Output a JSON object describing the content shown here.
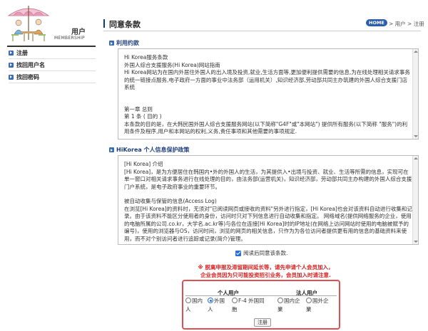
{
  "sidebar": {
    "logo_title": "用户",
    "logo_subtitle": "MEMBERSHIP",
    "items": [
      {
        "label": "注册"
      },
      {
        "label": "找回用户名"
      },
      {
        "label": "找回密码"
      }
    ]
  },
  "header": {
    "title": "同意条款",
    "home_label": "HOME",
    "breadcrumb": "> 用户 > 注册"
  },
  "terms": {
    "heading": "利用约款",
    "lines": [
      "Hi Korea服务条款",
      "外国人综合支援服务(Hi Korea)网站指南",
      "Hi Korea网站为在国内外居住外国人的出入境及投资,就业,生活方面等,更加便利提供需要的信息,为在线处理相关请求事务的统一链接点服务,电子政府一方面的事业中法务部（运用机关）,知识经济部,劳动部共同主办筑建的外国人综合支援门店系统",
      "",
      "第一章 总则",
      "第 1 条 ( 目的 )",
      "本条款的目的是，在大韩民国外国人综合支援服务网站(以下简称\"G4F\"或\"本网站\") 提供所有服务(以下简称 \"服务\")的利用条件及程序,用户和本网站的权利,义务,责任事项和其他需要的事项规定."
    ]
  },
  "privacy": {
    "heading": "HiKorea 个人信息保护政策",
    "lines": [
      "[Hi Korea] 介绍",
      "[Hi Korea]，是为方便居住在韩国内•外的外国人的生活，为其提供入•出境与投资、就业、生活等所需的信息，实现可在单一窗口对相关请求事务进行在线处理的目的，由法务部(运营机关)，知识经济部，劳动部共同主办构建的外国人综合支援门户系统，是电子政府事业的重要环节。",
      "",
      "被自动收集与保管的信息(Access Log)",
      "在浏览[Hi Korea]的资料时，无须对\"已阅读网页或接收的资料\"另外进行指定，[Hi Korea]也会对该资料自动进行收集和记录。由于该资料不能区分使用者的身份，访问时只对下列信息进行自动收集和指定。 网络域名(提供网络服务的企业，使用的电脑所属的公司.co.kr，大学名.ac.kr等)与各位在连接[Hi Korea]时的IP地址(在网络上访问网站时使用的电脑被赋予的编号)，使用的浏览器与OS，访问时间，浏览的网页的相关信息，只作为为各位访问者提供更有用的信息的基础资料来使用，而不对个别访问者进行追踪或记录(简介)管理。"
    ]
  },
  "agree": {
    "label": "阅读后同意该条款."
  },
  "notice": {
    "line1": "※ 脱离申报及滞留期间延长等，请先申请个人会员加入，",
    "line2": "企业会员因为只可能投资招引业务，会员加入时请注意."
  },
  "member_type": {
    "personal_label": "个人用户",
    "corporate_label": "法人用户",
    "options": [
      {
        "line1": "国内",
        "line2": "人",
        "selected": false
      },
      {
        "line1": "外国",
        "line2": "人",
        "selected": true
      },
      {
        "line1": "F-4 外国同",
        "line2": "胞",
        "selected": false
      },
      {
        "line1": "国内企",
        "line2": "業",
        "selected": false
      },
      {
        "line1": "国外企",
        "line2": "業",
        "selected": false
      }
    ],
    "register_label": "注册"
  }
}
